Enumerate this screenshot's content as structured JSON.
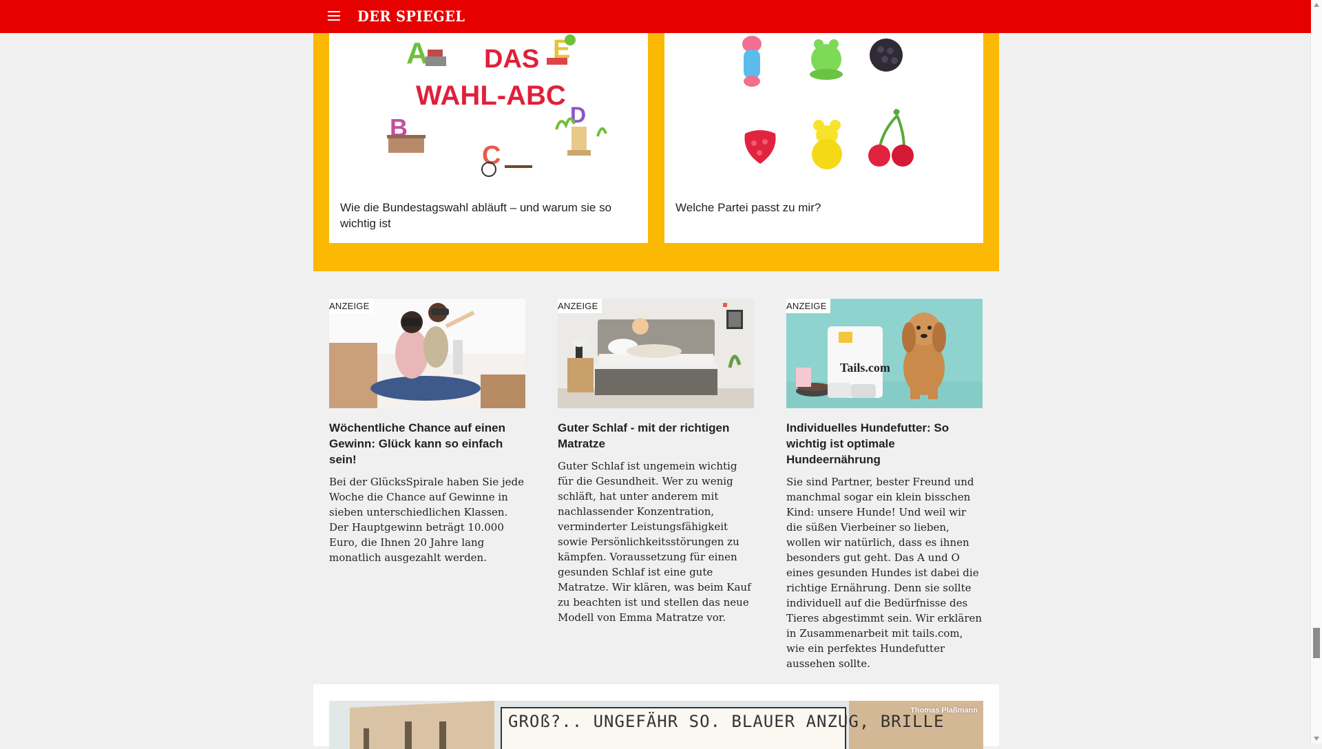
{
  "header": {
    "logo": "DER SPIEGEL",
    "menu_icon": "hamburger-menu-icon",
    "background": "#e60000"
  },
  "wahl_section": {
    "background": "#fbb904",
    "cards": [
      {
        "title": "Wie die Bundestagswahl abläuft – und warum sie so wichtig ist",
        "image_text": [
          "DAS",
          "WAHL-ABC"
        ]
      },
      {
        "title": "Welche Partei passt zu mir?",
        "image": "gummy-candies-illustration"
      }
    ]
  },
  "ads": [
    {
      "label": "Anzeige",
      "headline": "Wöchentliche Chance auf einen Gewinn: Glück kann so einfach sein!",
      "body": "Bei der GlücksSpirale haben Sie jede Woche die Chance auf Gewinne in sieben unterschiedlichen Klassen. Der Hauptgewinn beträgt 10.000 Euro, die Ihnen 20 Jahre lang monatlich ausgezahlt werden."
    },
    {
      "label": "Anzeige",
      "headline": "Guter Schlaf - mit der richtigen Matratze",
      "body": "Guter Schlaf ist ungemein wichtig für die Gesundheit. Wer zu wenig schläft, hat unter anderem mit nachlassender Konzentration, verminderter Leistungsfähigkeit sowie Persönlichkeitsstörungen zu kämpfen. Voraussetzung für einen gesunden Schlaf ist eine gute Matratze. Wir klären, was beim Kauf zu beachten ist und stellen das neue Modell von Emma Matratze vor."
    },
    {
      "label": "Anzeige",
      "headline": "Individuelles Hundefutter: So wichtig ist optimale Hundeernährung",
      "body": "Sie sind Partner, bester Freund und manchmal sogar ein klein bisschen Kind: unsere Hunde! Und weil wir die süßen Vierbeiner so lieben, wollen wir natürlich, dass es ihnen besonders gut geht. Das A und O eines gesunden Hundes ist dabei die richtige Ernährung. Denn sie sollte individuell auf die Bedürfnisse des Tieres abgestimmt sein. Wir erklären in Zusammenarbeit mit tails.com, wie ein perfektes Hundefutter aussehen sollte.",
      "image_text": "Tails.com"
    }
  ],
  "cartoon": {
    "credit": "Thomas Plaßmann",
    "text": "GROß?.. UNGEFÄHR SO. BLAUER ANZUG, BRILLE"
  }
}
